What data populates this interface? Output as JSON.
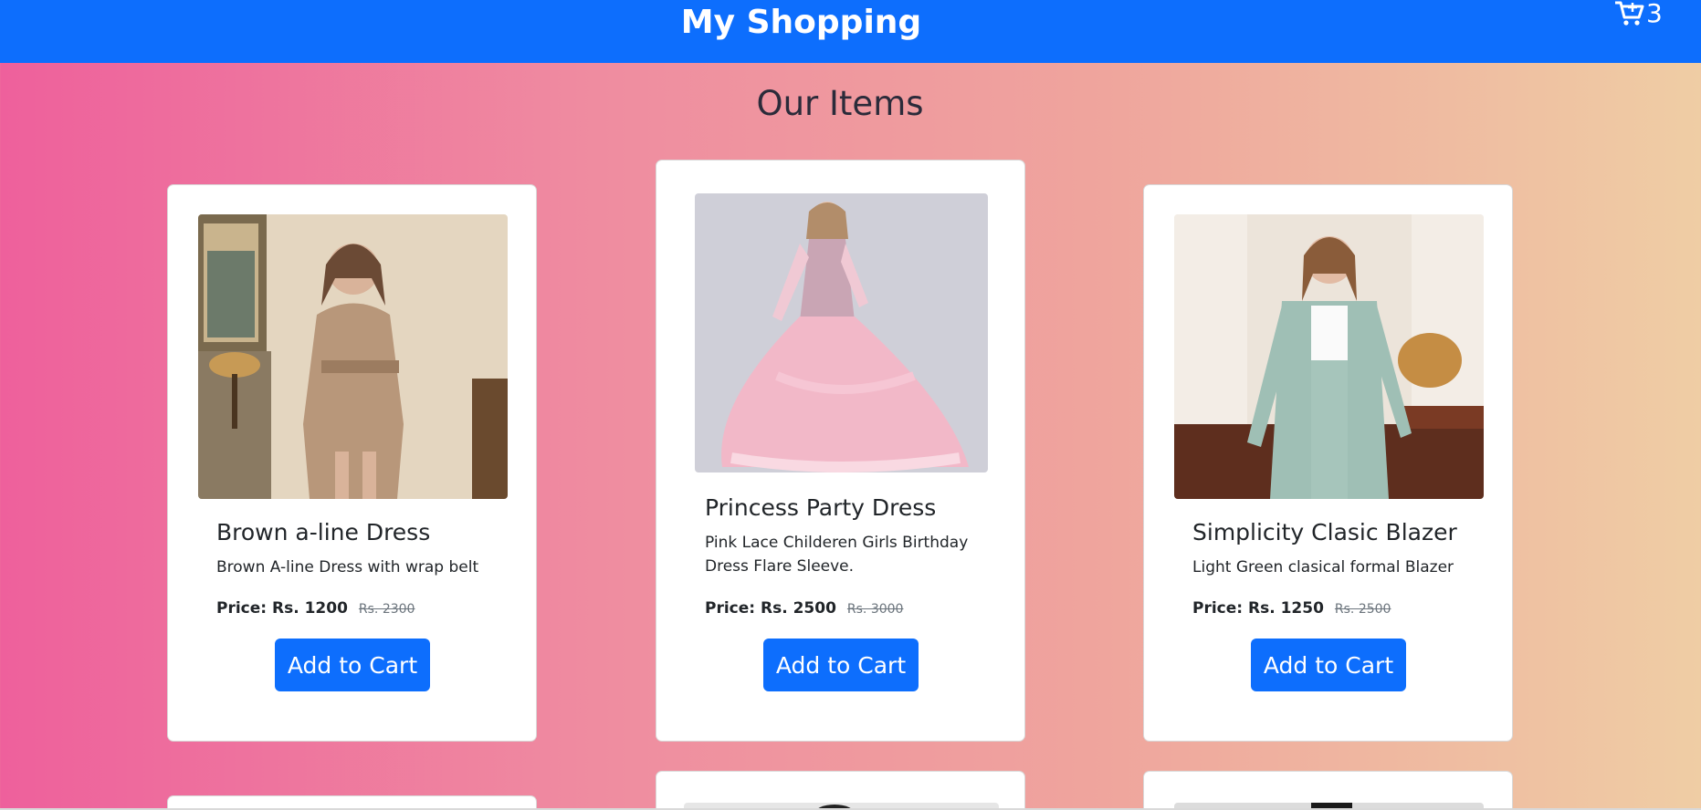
{
  "navbar": {
    "brand": "My Shopping",
    "cart_icon": "cart-plus-icon",
    "cart_count": "3",
    "bg_color": "#0d6efd"
  },
  "section": {
    "title": "Our Items"
  },
  "products": [
    {
      "title": "Brown a-line Dress",
      "description": "Brown A-line Dress with wrap belt",
      "price": "Price: Rs. 1200",
      "old_price": "Rs. 2300",
      "button": "Add to Cart"
    },
    {
      "title": "Princess Party Dress",
      "description": "Pink Lace Childeren Girls Birthday Dress Flare Sleeve.",
      "price": "Price: Rs. 2500",
      "old_price": "Rs. 3000",
      "button": "Add to Cart"
    },
    {
      "title": "Simplicity Clasic Blazer",
      "description": "Light Green clasical formal Blazer",
      "price": "Price: Rs. 1250",
      "old_price": "Rs. 2500",
      "button": "Add to Cart"
    }
  ],
  "colors": {
    "accent": "#0d6efd",
    "gradient_start": "#ee609c",
    "gradient_end": "#efcda4"
  }
}
